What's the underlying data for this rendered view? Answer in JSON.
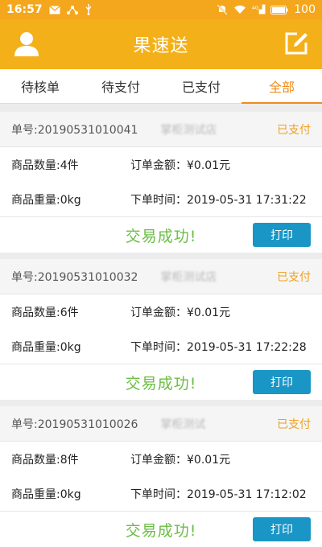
{
  "status_bar": {
    "time": "16:57",
    "battery": "100"
  },
  "app": {
    "title": "果速送"
  },
  "tabs": [
    {
      "label": "待核单",
      "active": false
    },
    {
      "label": "待支付",
      "active": false
    },
    {
      "label": "已支付",
      "active": false
    },
    {
      "label": "全部",
      "active": true
    }
  ],
  "orders": [
    {
      "order_no": "单号:20190531010041",
      "shop": "掌柜测试店",
      "status": "已支付",
      "quantity": "商品数量:4件",
      "amount": "订单金额：¥0.01元",
      "weight": "商品重量:0kg",
      "time": "下单时间：2019-05-31 17:31:22",
      "result": "交易成功!",
      "print_label": "打印"
    },
    {
      "order_no": "单号:20190531010032",
      "shop": "掌柜测试店",
      "status": "已支付",
      "quantity": "商品数量:6件",
      "amount": "订单金额：¥0.01元",
      "weight": "商品重量:0kg",
      "time": "下单时间：2019-05-31 17:22:28",
      "result": "交易成功!",
      "print_label": "打印"
    },
    {
      "order_no": "单号:20190531010026",
      "shop": "掌柜测试",
      "status": "已支付",
      "quantity": "商品数量:8件",
      "amount": "订单金额：¥0.01元",
      "weight": "商品重量:0kg",
      "time": "下单时间：2019-05-31 17:12:02",
      "result": "交易成功!",
      "print_label": "打印"
    }
  ],
  "colors": {
    "header": "#f4b019",
    "accent": "#f08c1a",
    "success": "#6cbd45",
    "button": "#1a96c6"
  }
}
